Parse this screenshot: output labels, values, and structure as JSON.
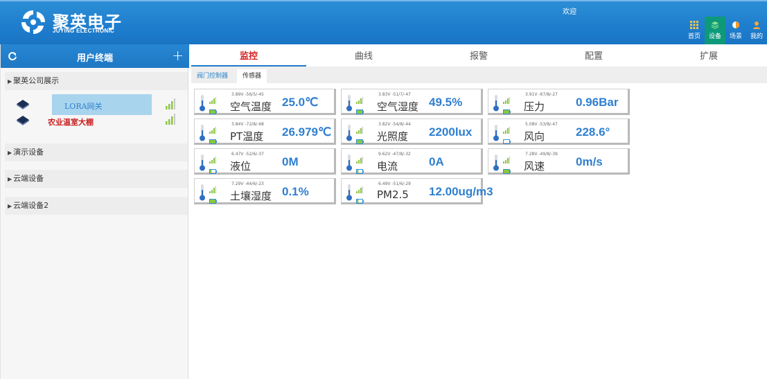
{
  "header": {
    "brand_name": "聚英电子",
    "brand_sub": "JUYING ELECTRONIC",
    "welcome": "欢迎",
    "nav": [
      {
        "label": "首页",
        "icon": "grid-icon"
      },
      {
        "label": "设备",
        "icon": "layers-icon"
      },
      {
        "label": "场景",
        "icon": "contrast-icon"
      },
      {
        "label": "我的",
        "icon": "user-icon"
      }
    ],
    "accent": "#1f7fcf",
    "active_nav_color": "#0e9a7a"
  },
  "sidebar": {
    "title": "用户终端",
    "add_label": "+",
    "groups": [
      {
        "label": "聚英公司展示"
      },
      {
        "label": "演示设备"
      },
      {
        "label": "云端设备"
      },
      {
        "label": "云端设备2"
      }
    ],
    "devices": [
      {
        "label": "LORA网关",
        "color": "#2f7fd0"
      },
      {
        "label": "农业温室大棚",
        "color": "#c81e1e"
      }
    ]
  },
  "tabs": [
    {
      "label": "监控"
    },
    {
      "label": "曲线"
    },
    {
      "label": "报警"
    },
    {
      "label": "配置"
    },
    {
      "label": "扩展"
    }
  ],
  "subtabs": [
    {
      "label": "阀门控制器"
    },
    {
      "label": "传感器"
    }
  ],
  "sensors": [
    {
      "meta": "3.89V  -56/5/-45",
      "label": "空气温度",
      "value": "25.0℃",
      "battery_level": 1.0
    },
    {
      "meta": "3.83V  -51/7/-47",
      "label": "空气湿度",
      "value": "49.5%",
      "battery_level": 1.0
    },
    {
      "meta": "3.91V  -67/8/-27",
      "label": "压力",
      "value": "0.96Bar",
      "battery_level": 1.0
    },
    {
      "meta": "3.84V  -72/8/-68",
      "label": "PT温度",
      "value": "26.979℃",
      "battery_level": 1.0
    },
    {
      "meta": "3.82V  -54/8/-44",
      "label": "光照度",
      "value": "2200lux",
      "battery_level": 1.0
    },
    {
      "meta": "5.08V  -53/8/-47",
      "label": "风向",
      "value": "228.6°",
      "battery_level": 0.0
    },
    {
      "meta": "6.47V  -52/6/-37",
      "label": "液位",
      "value": "0M",
      "battery_level": 0.3
    },
    {
      "meta": "9.62V  -47/8/-32",
      "label": "电流",
      "value": "0A",
      "battery_level": 0.3
    },
    {
      "meta": "7.28V  -49/8/-39",
      "label": "风速",
      "value": "0m/s",
      "battery_level": 1.0
    },
    {
      "meta": "7.29V  -44/6/-23",
      "label": "土壤湿度",
      "value": "0.1%",
      "battery_level": 1.0
    },
    {
      "meta": "6.49V  -51/6/-29",
      "label": "PM2.5",
      "value": "12.00ug/m3",
      "battery_level": 0.3
    }
  ]
}
